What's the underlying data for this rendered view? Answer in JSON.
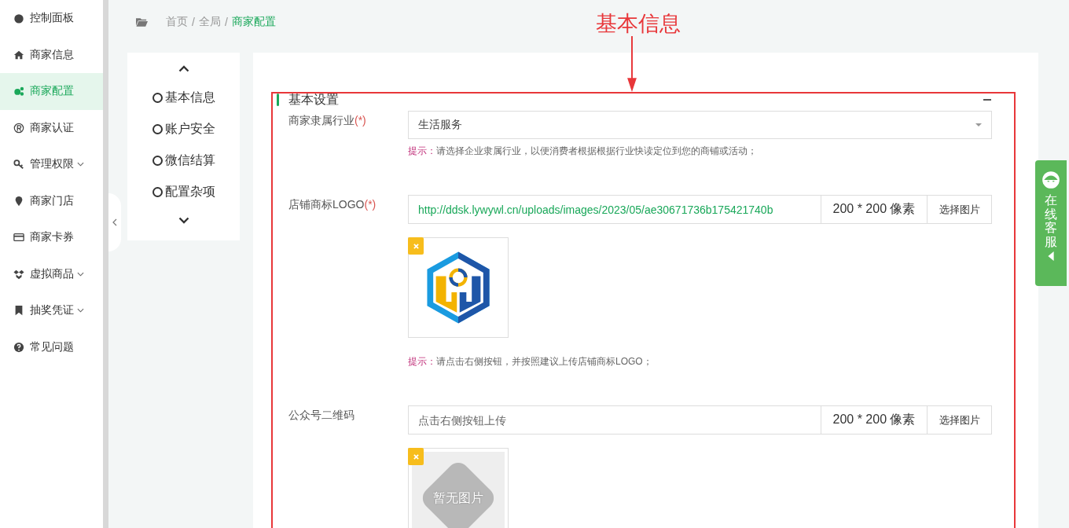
{
  "sidebar": {
    "items": [
      {
        "label": "控制面板",
        "selected": false,
        "has_submenu": false
      },
      {
        "label": "商家信息",
        "selected": false,
        "has_submenu": false
      },
      {
        "label": "商家配置",
        "selected": true,
        "has_submenu": false
      },
      {
        "label": "商家认证",
        "selected": false,
        "has_submenu": false
      },
      {
        "label": "管理权限",
        "selected": false,
        "has_submenu": true
      },
      {
        "label": "商家门店",
        "selected": false,
        "has_submenu": false
      },
      {
        "label": "商家卡券",
        "selected": false,
        "has_submenu": false
      },
      {
        "label": "虚拟商品",
        "selected": false,
        "has_submenu": true
      },
      {
        "label": "抽奖凭证",
        "selected": false,
        "has_submenu": true
      },
      {
        "label": "常见问题",
        "selected": false,
        "has_submenu": false
      }
    ]
  },
  "breadcrumb": [
    {
      "label": "首页",
      "current": false
    },
    {
      "separator": "/",
      "label": "全局",
      "current": false
    },
    {
      "separator": "/",
      "label": "商家配置",
      "current": true
    }
  ],
  "section_nav": {
    "items": [
      {
        "label": "基本信息"
      },
      {
        "label": "账户安全"
      },
      {
        "label": "微信结算"
      },
      {
        "label": "配置杂项"
      }
    ]
  },
  "section": {
    "title": "基本设置",
    "fields": [
      {
        "kind": "select",
        "label": "商家隶属行业",
        "required": "(*)",
        "value": "生活服务",
        "hint_label": "提示：",
        "hint": "请选择企业隶属行业，以便消费者根据根据行业快读定位到您的商铺或活动；"
      },
      {
        "kind": "image",
        "label": "店铺商标LOGO",
        "required": "(*)",
        "value": "http://ddsk.lywywl.cn/uploads/images/2023/05/ae30671736b175421740b",
        "size": "200 * 200 像素",
        "button": "选择图片",
        "preview": {
          "kind": "logo"
        },
        "hint_label": "提示：",
        "hint": "请点击右侧按钮，并按照建议上传店铺商标LOGO；"
      },
      {
        "kind": "image",
        "label": "公众号二维码",
        "placeholder": "点击右侧按钮上传",
        "size": "200 * 200 像素",
        "button": "选择图片",
        "preview": {
          "kind": "empty",
          "text": "暂无图片"
        }
      }
    ]
  },
  "annotation": {
    "label": "基本信息"
  },
  "float_tab": {
    "label": "在线客服"
  }
}
